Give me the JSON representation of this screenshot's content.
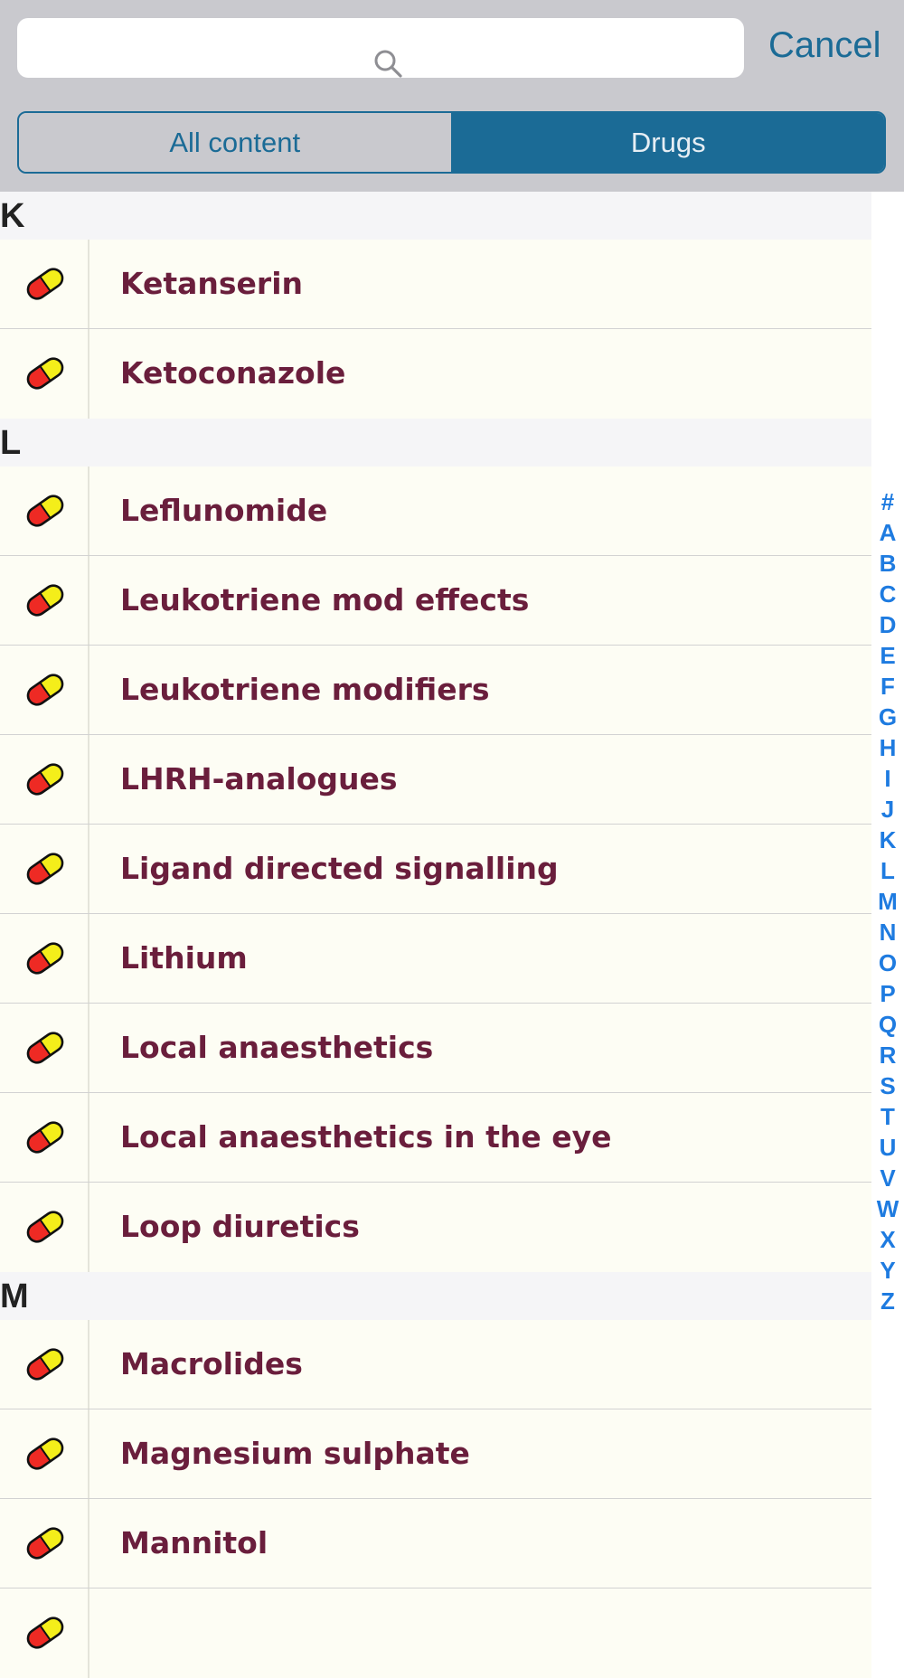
{
  "search": {
    "placeholder": ""
  },
  "cancel_label": "Cancel",
  "segments": {
    "all": "All content",
    "drugs": "Drugs",
    "selected": "Drugs"
  },
  "colors": {
    "accent": "#1b6b96",
    "item_text": "#6a1e3c",
    "index": "#1e7be0"
  },
  "sections": [
    {
      "letter": "K",
      "items": [
        "Ketanserin",
        "Ketoconazole"
      ]
    },
    {
      "letter": "L",
      "items": [
        "Leflunomide",
        "Leukotriene mod effects",
        "Leukotriene modifiers",
        "LHRH-analogues",
        "Ligand directed signalling",
        "Lithium",
        "Local anaesthetics",
        "Local anaesthetics in the eye",
        "Loop diuretics"
      ]
    },
    {
      "letter": "M",
      "items": [
        "Macrolides",
        "Magnesium sulphate",
        "Mannitol",
        ""
      ]
    }
  ],
  "item_icon": "pill-icon",
  "index_letters": [
    "#",
    "A",
    "B",
    "C",
    "D",
    "E",
    "F",
    "G",
    "H",
    "I",
    "J",
    "K",
    "L",
    "M",
    "N",
    "O",
    "P",
    "Q",
    "R",
    "S",
    "T",
    "U",
    "V",
    "W",
    "X",
    "Y",
    "Z"
  ]
}
